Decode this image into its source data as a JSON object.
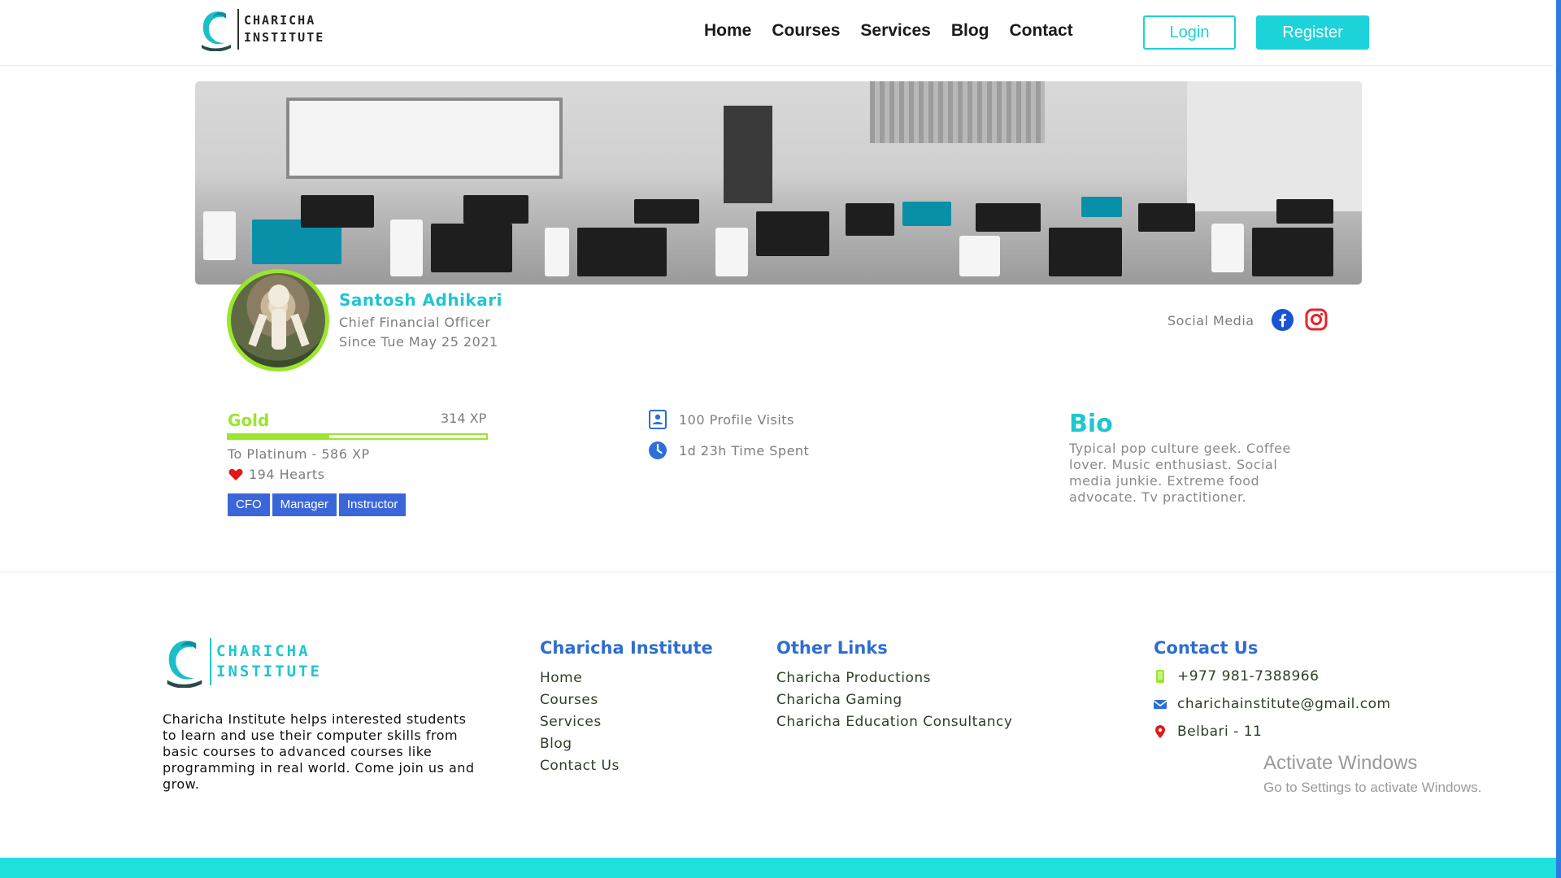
{
  "brand": {
    "name_line1": "CHARICHA",
    "name_line2": "INSTITUTE",
    "accent": "#1bd3d8",
    "secondary": "#2f6ecf",
    "level_color": "#9ae62e",
    "tag_color": "#3b66d9"
  },
  "nav": {
    "items": [
      "Home",
      "Courses",
      "Services",
      "Blog",
      "Contact"
    ],
    "login_label": "Login",
    "register_label": "Register"
  },
  "profile": {
    "name": "Santosh Adhikari",
    "role": "Chief Financial Officer",
    "since": "Since Tue May 25 2021",
    "social_label": "Social Media",
    "social_icons": [
      "facebook-icon",
      "instagram-icon"
    ]
  },
  "stats": {
    "level": "Gold",
    "xp": "314 XP",
    "progress_fraction": 0.39,
    "next_level": "To Platinum - 586 XP",
    "hearts": "194 Hearts",
    "tags": [
      "CFO",
      "Manager",
      "Instructor"
    ],
    "profile_visits": "100 Profile Visits",
    "time_spent": "1d 23h Time Spent"
  },
  "bio": {
    "title": "Bio",
    "text": "Typical pop culture geek. Coffee lover. Music enthusiast. Social media junkie. Extreme food advocate. Tv practitioner."
  },
  "footer": {
    "about": "Charicha Institute helps interested students to learn and use their computer skills from basic courses to advanced courses like programming in real world. Come join us and grow.",
    "col1": {
      "heading": "Charicha Institute",
      "links": [
        "Home",
        "Courses",
        "Services",
        "Blog",
        "Contact Us"
      ]
    },
    "col2": {
      "heading": "Other Links",
      "links": [
        "Charicha Productions",
        "Charicha Gaming",
        "Charicha Education Consultancy"
      ]
    },
    "contact": {
      "heading": "Contact Us",
      "phone": "+977 981-7388966",
      "email": "charichainstitute@gmail.com",
      "address": "Belbari - 11"
    }
  },
  "windows_watermark": {
    "line1": "Activate Windows",
    "line2": "Go to Settings to activate Windows."
  }
}
